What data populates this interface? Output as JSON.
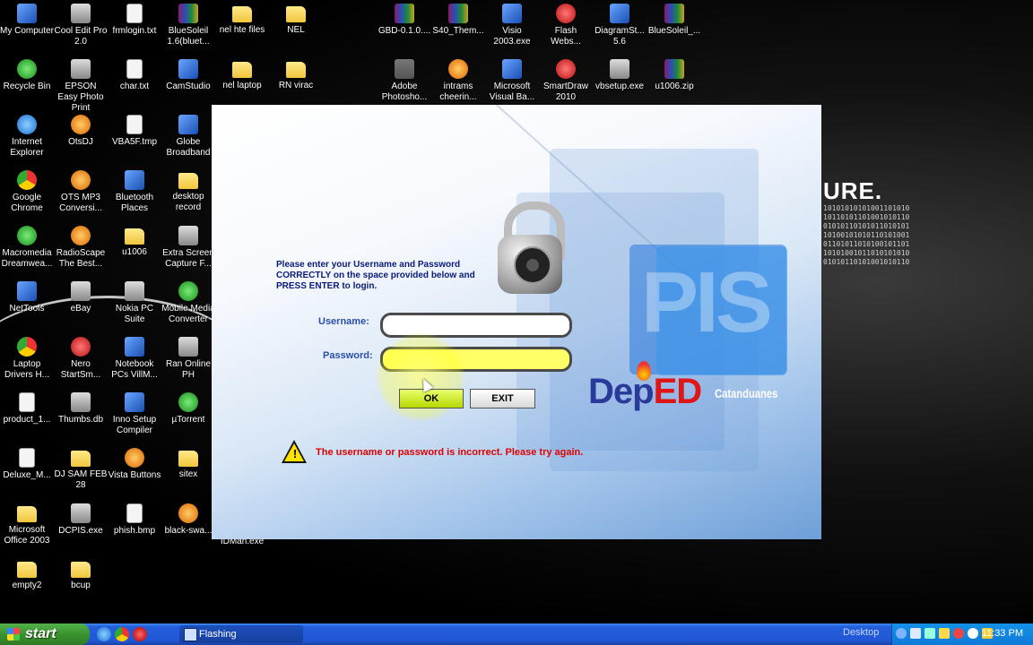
{
  "desktop": {
    "bg_text": "URE.",
    "bg_binary": "10101010101001101010\n10110101101001010110\n01010110101011010101\n10100101010110101001\n01101011010100101101\n10101001011010101010\n01010110101001010110",
    "icons": [
      {
        "label": "My Computer",
        "icon": "computer-icon",
        "kind": "app"
      },
      {
        "label": "Cool Edit Pro 2.0",
        "icon": "cool-edit-icon",
        "kind": "gray"
      },
      {
        "label": "frmlogin.txt",
        "icon": "text-file-icon",
        "kind": "file"
      },
      {
        "label": "BlueSoleil 1.6(bluet...",
        "icon": "winrar-icon",
        "kind": "rar"
      },
      {
        "label": "nel hte files",
        "icon": "folder-icon",
        "kind": "folder"
      },
      {
        "label": "NEL",
        "icon": "folder-icon",
        "kind": "folder"
      },
      {
        "label": "GBD-0.1.0....",
        "icon": "winrar-icon",
        "kind": "rar"
      },
      {
        "label": "S40_Them...",
        "icon": "winrar-icon",
        "kind": "rar"
      },
      {
        "label": "Visio 2003.exe",
        "icon": "visio-icon",
        "kind": "app"
      },
      {
        "label": "Flash Webs...",
        "icon": "flash-icon",
        "kind": "red"
      },
      {
        "label": "DiagramSt... 5.6",
        "icon": "diagram-icon",
        "kind": "app"
      },
      {
        "label": "BlueSoleil_...",
        "icon": "winrar-icon",
        "kind": "rar"
      },
      {
        "label": "Recycle Bin",
        "icon": "recycle-bin-icon",
        "kind": "green"
      },
      {
        "label": "EPSON Easy Photo Print",
        "icon": "epson-icon",
        "kind": "gray"
      },
      {
        "label": "char.txt",
        "icon": "text-file-icon",
        "kind": "file"
      },
      {
        "label": "CamStudio",
        "icon": "camstudio-icon",
        "kind": "app"
      },
      {
        "label": "nel laptop",
        "icon": "folder-icon",
        "kind": "folder"
      },
      {
        "label": "RN virac",
        "icon": "folder-icon",
        "kind": "folder"
      },
      {
        "label": "Adobe Photosho...",
        "icon": "dark-folder-icon",
        "kind": "yellowfolder2"
      },
      {
        "label": "intrams cheerin...",
        "icon": "file-icon",
        "kind": "orange"
      },
      {
        "label": "Microsoft Visual Ba...",
        "icon": "visual-basic-icon",
        "kind": "app"
      },
      {
        "label": "SmartDraw 2010",
        "icon": "smartdraw-icon",
        "kind": "red"
      },
      {
        "label": "vbsetup.exe",
        "icon": "setup-icon",
        "kind": "gray"
      },
      {
        "label": "u1006.zip",
        "icon": "winrar-icon",
        "kind": "rar"
      },
      {
        "label": "Internet Explorer",
        "icon": "internet-explorer-icon",
        "kind": "ie"
      },
      {
        "label": "OtsDJ",
        "icon": "otsdj-icon",
        "kind": "orange"
      },
      {
        "label": "VBA5F.tmp",
        "icon": "file-icon",
        "kind": "file"
      },
      {
        "label": "Globe Broadband",
        "icon": "globe-icon",
        "kind": "app"
      },
      {
        "label": "Google Chrome",
        "icon": "chrome-icon",
        "kind": "chrome"
      },
      {
        "label": "OTS MP3 Conversi...",
        "icon": "ots-mp3-icon",
        "kind": "orange"
      },
      {
        "label": "Bluetooth Places",
        "icon": "bluetooth-icon",
        "kind": "app"
      },
      {
        "label": "desktop record",
        "icon": "folder-icon",
        "kind": "folder"
      },
      {
        "label": "Macromedia Dreamwea...",
        "icon": "dreamweaver-icon",
        "kind": "green"
      },
      {
        "label": "RadioScape The Best...",
        "icon": "radioscape-icon",
        "kind": "orange"
      },
      {
        "label": "u1006",
        "icon": "folder-icon",
        "kind": "folder"
      },
      {
        "label": "Extra Screen Capture F...",
        "icon": "screen-capture-icon",
        "kind": "gray"
      },
      {
        "label": "NetTools",
        "icon": "nettools-icon",
        "kind": "app"
      },
      {
        "label": "eBay",
        "icon": "ebay-icon",
        "kind": "gray"
      },
      {
        "label": "Nokia PC Suite",
        "icon": "nokia-icon",
        "kind": "gray"
      },
      {
        "label": "Mobile Media Converter",
        "icon": "media-converter-icon",
        "kind": "green"
      },
      {
        "label": "Laptop Drivers H...",
        "icon": "chrome-icon",
        "kind": "chrome"
      },
      {
        "label": "Nero StartSm...",
        "icon": "nero-icon",
        "kind": "red"
      },
      {
        "label": "Notebook PCs VillM...",
        "icon": "notebook-icon",
        "kind": "app"
      },
      {
        "label": "Ran Online PH",
        "icon": "ran-online-icon",
        "kind": "gray"
      },
      {
        "label": "product_1...",
        "icon": "file-icon",
        "kind": "file"
      },
      {
        "label": "Thumbs.db",
        "icon": "thumbs-db-icon",
        "kind": "gray"
      },
      {
        "label": "Inno Setup Compiler",
        "icon": "inno-setup-icon",
        "kind": "app"
      },
      {
        "label": "µTorrent",
        "icon": "utorrent-icon",
        "kind": "green"
      },
      {
        "label": "Deluxe_M...",
        "icon": "file-icon",
        "kind": "file"
      },
      {
        "label": "DJ SAM FEB 28",
        "icon": "folder-icon",
        "kind": "folder"
      },
      {
        "label": "Vista Buttons",
        "icon": "vista-buttons-icon",
        "kind": "orange"
      },
      {
        "label": "sitex",
        "icon": "folder-icon",
        "kind": "folder"
      },
      {
        "label": "Microsoft Office 2003",
        "icon": "folder-icon",
        "kind": "folder"
      },
      {
        "label": "DCPIS.exe",
        "icon": "exe-icon",
        "kind": "gray"
      },
      {
        "label": "phish.bmp",
        "icon": "bitmap-file-icon",
        "kind": "file"
      },
      {
        "label": "black-swa...",
        "icon": "file-icon",
        "kind": "orange"
      },
      {
        "label": "Shortcut to IDMan.exe",
        "icon": "idm-icon",
        "kind": "green"
      },
      {
        "label": "empty2",
        "icon": "folder-icon",
        "kind": "folder"
      },
      {
        "label": "bcup",
        "icon": "folder-icon",
        "kind": "folder"
      }
    ]
  },
  "login": {
    "instructions": "Please enter your Username and Password CORRECTLY on the space provided below and PRESS ENTER to login.",
    "username_label": "Username:",
    "password_label": "Password:",
    "username_value": "",
    "password_value": "",
    "ok_label": "OK",
    "exit_label": "EXIT",
    "error_message": "The username or password is incorrect. Please try again.",
    "warning_mark": "!",
    "logo_pis": "PIS",
    "logo_dep": "Dep",
    "logo_ed": "ED",
    "logo_location": "Catanduanes"
  },
  "taskbar": {
    "start_label": "start",
    "task_label": "Flashing",
    "deskbar_label": "Desktop",
    "clock": "11:33 PM",
    "quick_launch": [
      "internet-explorer-icon",
      "chrome-icon",
      "media-icon"
    ],
    "tray_icons": [
      "bluetooth-icon",
      "display-icon",
      "network-icon",
      "volume-icon",
      "antivirus-icon",
      "security-icon",
      "update-icon"
    ]
  },
  "colors": {
    "error_text": "#e00000",
    "instruction_text": "#0a1a7a",
    "deped_blue": "#2a3a9a",
    "deped_red": "#e01515",
    "taskbar_blue": "#245edb",
    "start_green": "#3a932f"
  }
}
